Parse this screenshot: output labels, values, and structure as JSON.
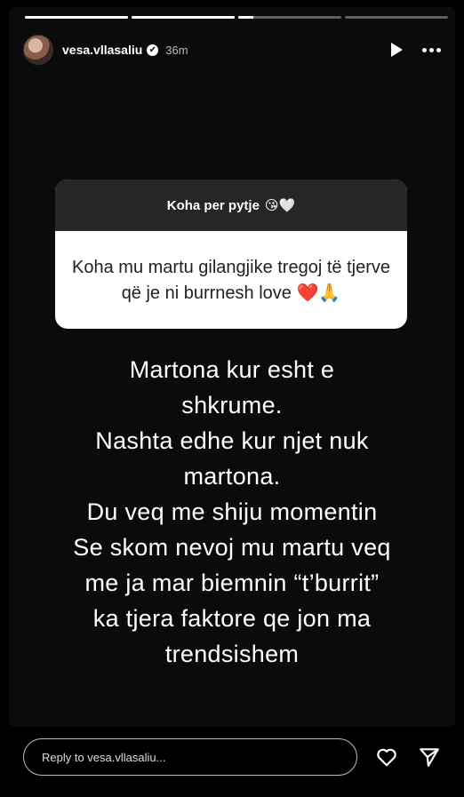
{
  "progress": [
    1.0,
    1.0,
    0.15,
    0.0
  ],
  "header": {
    "username": "vesa.vllasaliu",
    "verified_mark": "✔",
    "time": "36m",
    "icons": [
      "play-icon",
      "more-icon"
    ]
  },
  "question": {
    "title": "Koha per pytje",
    "title_emoji": "😘🤍",
    "answer_text": "Koha mu martu gilangjike tregoj të tjerve që je ni burrnesh love",
    "answer_emoji": "❤️🙏"
  },
  "caption": {
    "lines": [
      "Martona kur esht e",
      "shkrume.",
      "Nashta edhe kur njet nuk",
      "martona.",
      "Du veq me shiju momentin",
      "Se skom nevoj mu martu veq",
      "me ja mar biemnin “t’burrit”",
      "ka tjera faktore qe jon ma",
      "trendsishem"
    ]
  },
  "footer": {
    "reply_placeholder": "Reply to vesa.vllasaliu...",
    "icons": [
      "heart-icon",
      "send-icon"
    ]
  }
}
